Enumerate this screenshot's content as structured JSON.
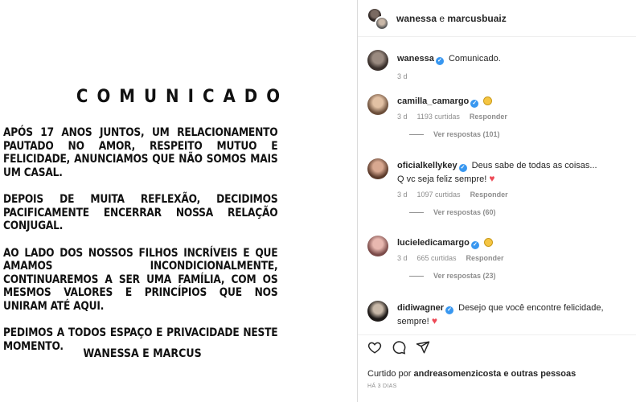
{
  "post": {
    "title": "COMUNICADO",
    "paragraphs": [
      "APÓS 17 ANOS JUNTOS, UM RELACIONAMENTO PAUTADO NO AMOR, RESPEITO MUTUO E FELICIDADE, ANUNCIAMOS QUE NÃO SOMOS MAIS UM CASAL.",
      "DEPOIS DE MUITA REFLEXÃO, DECIDIMOS PACIFICAMENTE ENCERRAR NOSSA RELAÇÃO CONJUGAL.",
      "AO LADO DOS NOSSOS FILHOS INCRÍVEIS E QUE AMAMOS INCONDICIONALMENTE, CONTINUAREMOS A SER UMA FAMÍLIA, COM OS MESMOS VALORES E PRINCÍPIOS QUE NOS UNIRAM ATÉ AQUI.",
      "PEDIMOS A TODOS ESPAÇO E PRIVACIDADE NESTE MOMENTO."
    ],
    "signature": "WANESSA E MARCUS"
  },
  "header": {
    "user1": "wanessa",
    "separator": " e ",
    "user2": "marcusbuaiz"
  },
  "caption": {
    "username": "wanessa",
    "text": "Comunicado.",
    "time": "3 d"
  },
  "comments": [
    {
      "username": "camilla_camargo",
      "text": "",
      "emoji": "face",
      "time": "3 d",
      "likes": "1193 curtidas",
      "reply": "Responder",
      "replies": "Ver respostas (101)"
    },
    {
      "username": "oficialkellykey",
      "text": "Deus sabe de todas as coisas... Q vc seja feliz sempre!",
      "emoji": "heart",
      "time": "3 d",
      "likes": "1097 curtidas",
      "reply": "Responder",
      "replies": "Ver respostas (60)"
    },
    {
      "username": "lucieledicamargo",
      "text": "",
      "emoji": "face",
      "time": "3 d",
      "likes": "665 curtidas",
      "reply": "Responder",
      "replies": "Ver respostas (23)"
    },
    {
      "username": "didiwagner",
      "text": "Desejo que você encontre felicidade, sempre!",
      "emoji": "heart"
    }
  ],
  "footer": {
    "liked_prefix": "Curtido por ",
    "liked_user": "andreasomenzicosta",
    "liked_suffix": " e outras pessoas",
    "time_ago": "HÁ 3 DIAS"
  },
  "colors": {
    "verified": "#3897f0",
    "heart": "#ed4956",
    "muted": "#8e8e8e"
  }
}
